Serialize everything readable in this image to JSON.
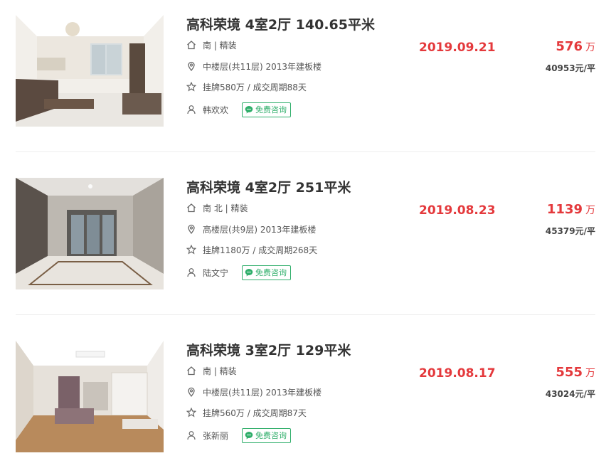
{
  "listings": [
    {
      "title": "高科荣境 4室2厅 140.65平米",
      "house_info": "南 | 精装",
      "position_info": "中楼层(共11层) 2013年建板楼",
      "deal_info": "挂牌580万 / 成交周期88天",
      "agent": "韩欢欢",
      "consult_label": "免费咨询",
      "deal_date": "2019.09.21",
      "total_price": "576",
      "total_price_unit": "万",
      "unit_price": "40953元/平"
    },
    {
      "title": "高科荣境 4室2厅 251平米",
      "house_info": "南 北 | 精装",
      "position_info": "高楼层(共9层) 2013年建板楼",
      "deal_info": "挂牌1180万 / 成交周期268天",
      "agent": "陆文宁",
      "consult_label": "免费咨询",
      "deal_date": "2019.08.23",
      "total_price": "1139",
      "total_price_unit": "万",
      "unit_price": "45379元/平"
    },
    {
      "title": "高科荣境 3室2厅 129平米",
      "house_info": "南 | 精装",
      "position_info": "中楼层(共11层) 2013年建板楼",
      "deal_info": "挂牌560万 / 成交周期87天",
      "agent": "张新丽",
      "consult_label": "免费咨询",
      "deal_date": "2019.08.17",
      "total_price": "555",
      "total_price_unit": "万",
      "unit_price": "43024元/平"
    }
  ],
  "colors": {
    "price_red": "#e4393c",
    "consult_green": "#2fae6a",
    "divider": "#eeeeee"
  },
  "icons": {
    "house": "house-icon",
    "position": "location-pin-icon",
    "follow": "star-icon",
    "agent": "person-icon",
    "consult": "chat-bubble-icon"
  }
}
